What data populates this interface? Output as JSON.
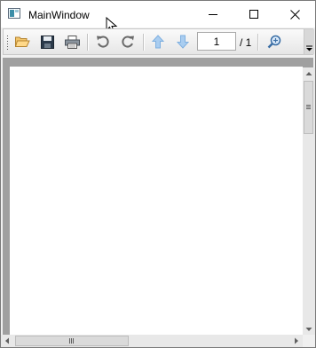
{
  "window": {
    "title": "MainWindow"
  },
  "toolbar": {
    "buttons": [
      {
        "name": "open",
        "icon": "folder-open-icon"
      },
      {
        "name": "save",
        "icon": "save-icon"
      },
      {
        "name": "print",
        "icon": "print-icon"
      },
      {
        "name": "rotate-left",
        "icon": "rotate-left-icon"
      },
      {
        "name": "rotate-right",
        "icon": "rotate-right-icon"
      },
      {
        "name": "previous-page",
        "icon": "arrow-up-icon"
      },
      {
        "name": "next-page",
        "icon": "arrow-down-icon"
      },
      {
        "name": "zoom",
        "icon": "magnifier-icon"
      }
    ],
    "page_number": "1",
    "page_total": "/ 1"
  },
  "colors": {
    "accent_blue": "#7fb0e0",
    "folder": "#e8b14a"
  }
}
